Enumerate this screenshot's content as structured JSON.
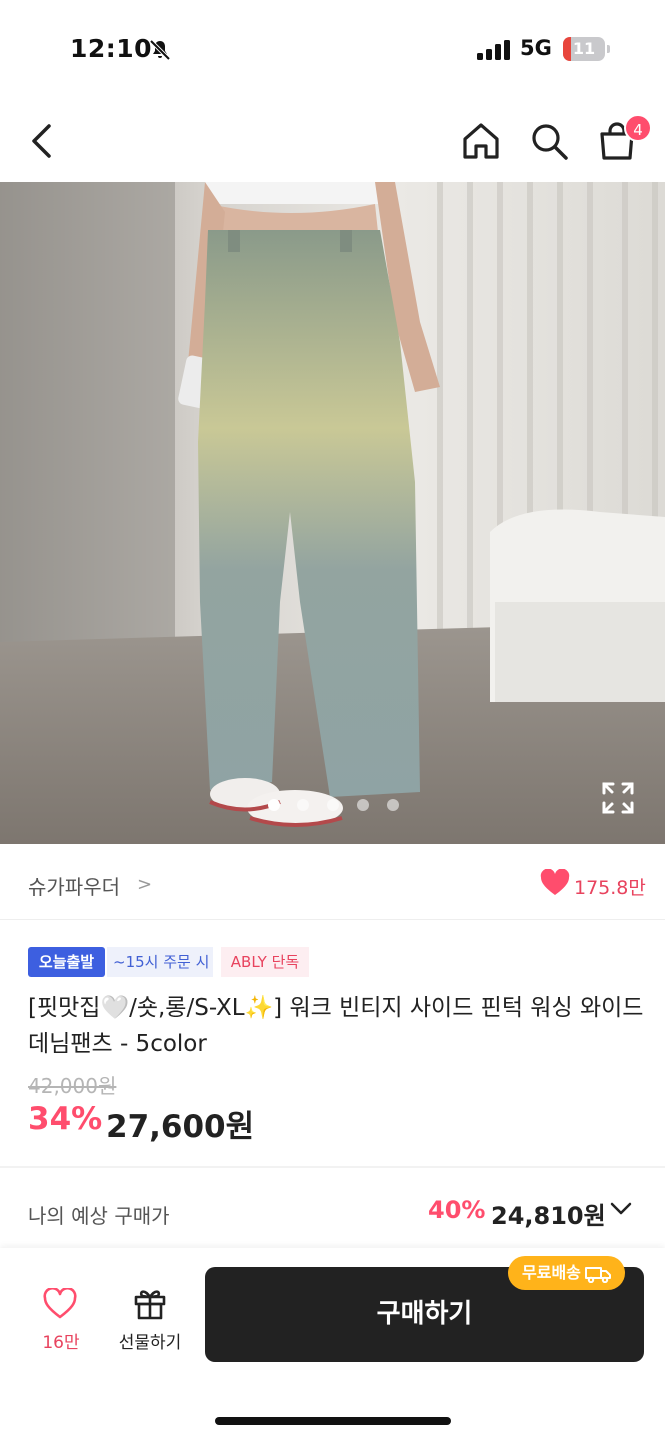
{
  "status": {
    "time": "12:10",
    "network": "5G",
    "battery": "11"
  },
  "nav": {
    "cart_count": "4"
  },
  "gallery": {
    "dot_count": 5,
    "active_index": 0
  },
  "store": {
    "name": "슈가파우더",
    "chevron": ">",
    "likes": "175.8만"
  },
  "badges": {
    "today": "오늘출발",
    "time": "~15시 주문 시",
    "ably": "ABLY 단독"
  },
  "product": {
    "title": "[핏맛집🤍/숏,롱/S-XL✨] 워크 빈티지 사이드 핀턱 워싱 와이드 데님팬츠 - 5color",
    "original_price": "42,000원",
    "discount": "34%",
    "price": "27,600원"
  },
  "expected": {
    "label": "나의 예상 구매가",
    "discount": "40%",
    "price": "24,810원"
  },
  "bottom": {
    "wish_count": "16만",
    "gift_label": "선물하기",
    "buy_label": "구매하기",
    "shipping_badge": "무료배송"
  },
  "colors": {
    "accent": "#ff4d6d",
    "button": "#222222",
    "badge_blue": "#3d5fe0",
    "shipping": "#ffb31a"
  }
}
